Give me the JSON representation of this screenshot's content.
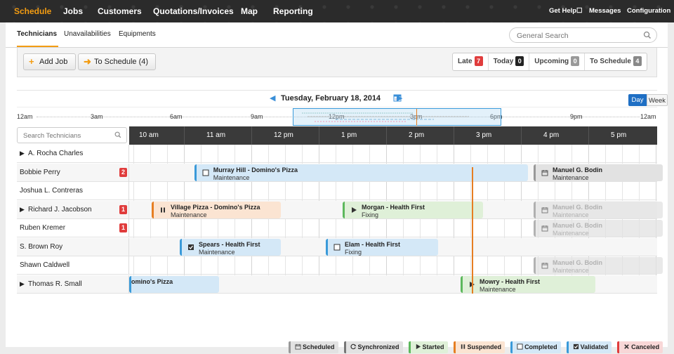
{
  "nav": {
    "left": [
      "Schedule",
      "Jobs",
      "Customers",
      "Quotations/Invoices",
      "Map",
      "Reporting"
    ],
    "right": [
      "Get Help☐",
      "Messages",
      "Configuration"
    ]
  },
  "subtabs": [
    "Technicians",
    "Unavailabilities",
    "Equipments"
  ],
  "search": {
    "placeholder": "General Search"
  },
  "toolbar": {
    "add_job": "Add Job",
    "to_schedule": "To Schedule (4)"
  },
  "status_filters": [
    {
      "label": "Late",
      "count": "7",
      "color": "#e03c3c"
    },
    {
      "label": "Today",
      "count": "0",
      "color": "#222222"
    },
    {
      "label": "Upcoming",
      "count": "0",
      "color": "#999999"
    },
    {
      "label": "To Schedule",
      "count": "4",
      "color": "#888888"
    }
  ],
  "date": {
    "label": "Tuesday, February 18, 2014",
    "view_day": "Day",
    "view_week": "Week"
  },
  "overview_hours": [
    "12am",
    "3am",
    "6am",
    "9am",
    "12pm",
    "3pm",
    "6pm",
    "9pm",
    "12am"
  ],
  "tech_search": {
    "placeholder": "Search Technicians"
  },
  "hours": [
    "10 am",
    "11 am",
    "12 pm",
    "1 pm",
    "2 pm",
    "3 pm",
    "4 pm",
    "5 pm"
  ],
  "technicians": [
    {
      "name": "A. Rocha Charles",
      "expandable": true,
      "badge": ""
    },
    {
      "name": "Bobbie Perry",
      "expandable": false,
      "badge": "2"
    },
    {
      "name": "Joshua L. Contreras",
      "expandable": false,
      "badge": ""
    },
    {
      "name": "Richard J. Jacobson",
      "expandable": true,
      "badge": "1"
    },
    {
      "name": "Ruben Kremer",
      "expandable": false,
      "badge": "1"
    },
    {
      "name": "S. Brown Roy",
      "expandable": false,
      "badge": ""
    },
    {
      "name": "Shawn Caldwell",
      "expandable": false,
      "badge": ""
    },
    {
      "name": "Thomas R. Small",
      "expandable": true,
      "badge": ""
    }
  ],
  "jobs": [
    {
      "row": 1,
      "title": "Murray Hill - Domino's Pizza",
      "type": "Maintenance",
      "status": "completed",
      "color": "blue",
      "icon": "checkbox-empty-icon",
      "start": "10:58",
      "end": "15:55"
    },
    {
      "row": 1,
      "title": "Manuel G. Bodin",
      "type": "Maintenance",
      "status": "scheduled",
      "color": "gray",
      "icon": "calendar-icon",
      "start": "16:00",
      "end": "17:55"
    },
    {
      "row": 3,
      "title": "Village Pizza - Domino's Pizza",
      "type": "Maintenance",
      "status": "suspended",
      "color": "orange",
      "icon": "pause-icon",
      "start": "10:20",
      "end": "12:15"
    },
    {
      "row": 3,
      "title": "Morgan - Health First",
      "type": "Fixing",
      "status": "started",
      "color": "green",
      "icon": "play-icon",
      "start": "13:10",
      "end": "15:15"
    },
    {
      "row": 3,
      "title": "Manuel G. Bodin",
      "type": "Maintenance",
      "status": "scheduled",
      "color": "gray",
      "icon": "calendar-icon",
      "start": "16:00",
      "end": "17:55"
    },
    {
      "row": 4,
      "title": "Manuel G. Bodin",
      "type": "Maintenance",
      "status": "scheduled",
      "color": "gray",
      "icon": "calendar-icon",
      "start": "16:00",
      "end": "17:55"
    },
    {
      "row": 5,
      "title": "Spears - Health First",
      "type": "Maintenance",
      "status": "validated",
      "color": "blue",
      "icon": "checkbox-checked-icon",
      "start": "10:45",
      "end": "12:15"
    },
    {
      "row": 5,
      "title": "Elam - Health First",
      "type": "Fixing",
      "status": "completed",
      "color": "blue",
      "icon": "checkbox-empty-icon",
      "start": "12:55",
      "end": "14:35"
    },
    {
      "row": 6,
      "title": "Manuel G. Bodin",
      "type": "Maintenance",
      "status": "scheduled",
      "color": "gray",
      "icon": "calendar-icon",
      "start": "16:00",
      "end": "17:55"
    },
    {
      "row": 7,
      "title": "omino's Pizza",
      "type": "",
      "status": "completed",
      "color": "blue",
      "icon": "",
      "start": "10:00",
      "end": "11:20"
    },
    {
      "row": 7,
      "title": "Mowry - Health First",
      "type": "Maintenance",
      "status": "started",
      "color": "green",
      "icon": "play-icon",
      "start": "14:55",
      "end": "16:55"
    }
  ],
  "now_time": "15:05",
  "legend": [
    {
      "label": "Scheduled",
      "icon": "calendar-icon",
      "color": "#999999",
      "bg": "#e2e2e2"
    },
    {
      "label": "Synchronized",
      "icon": "sync-icon",
      "color": "#777777",
      "bg": "#e2e2e2"
    },
    {
      "label": "Started",
      "icon": "play-icon",
      "color": "#5cb85c",
      "bg": "#dff0d8"
    },
    {
      "label": "Suspended",
      "icon": "pause-icon",
      "color": "#e67e22",
      "bg": "#fbe4d2"
    },
    {
      "label": "Completed",
      "icon": "checkbox-empty-icon",
      "color": "#3a9ad9",
      "bg": "#d4e8f7"
    },
    {
      "label": "Validated",
      "icon": "checkbox-checked-icon",
      "color": "#3a9ad9",
      "bg": "#d4e8f7"
    },
    {
      "label": "Canceled",
      "icon": "close-icon",
      "color": "#e03c3c",
      "bg": "#f8d7d7"
    }
  ]
}
